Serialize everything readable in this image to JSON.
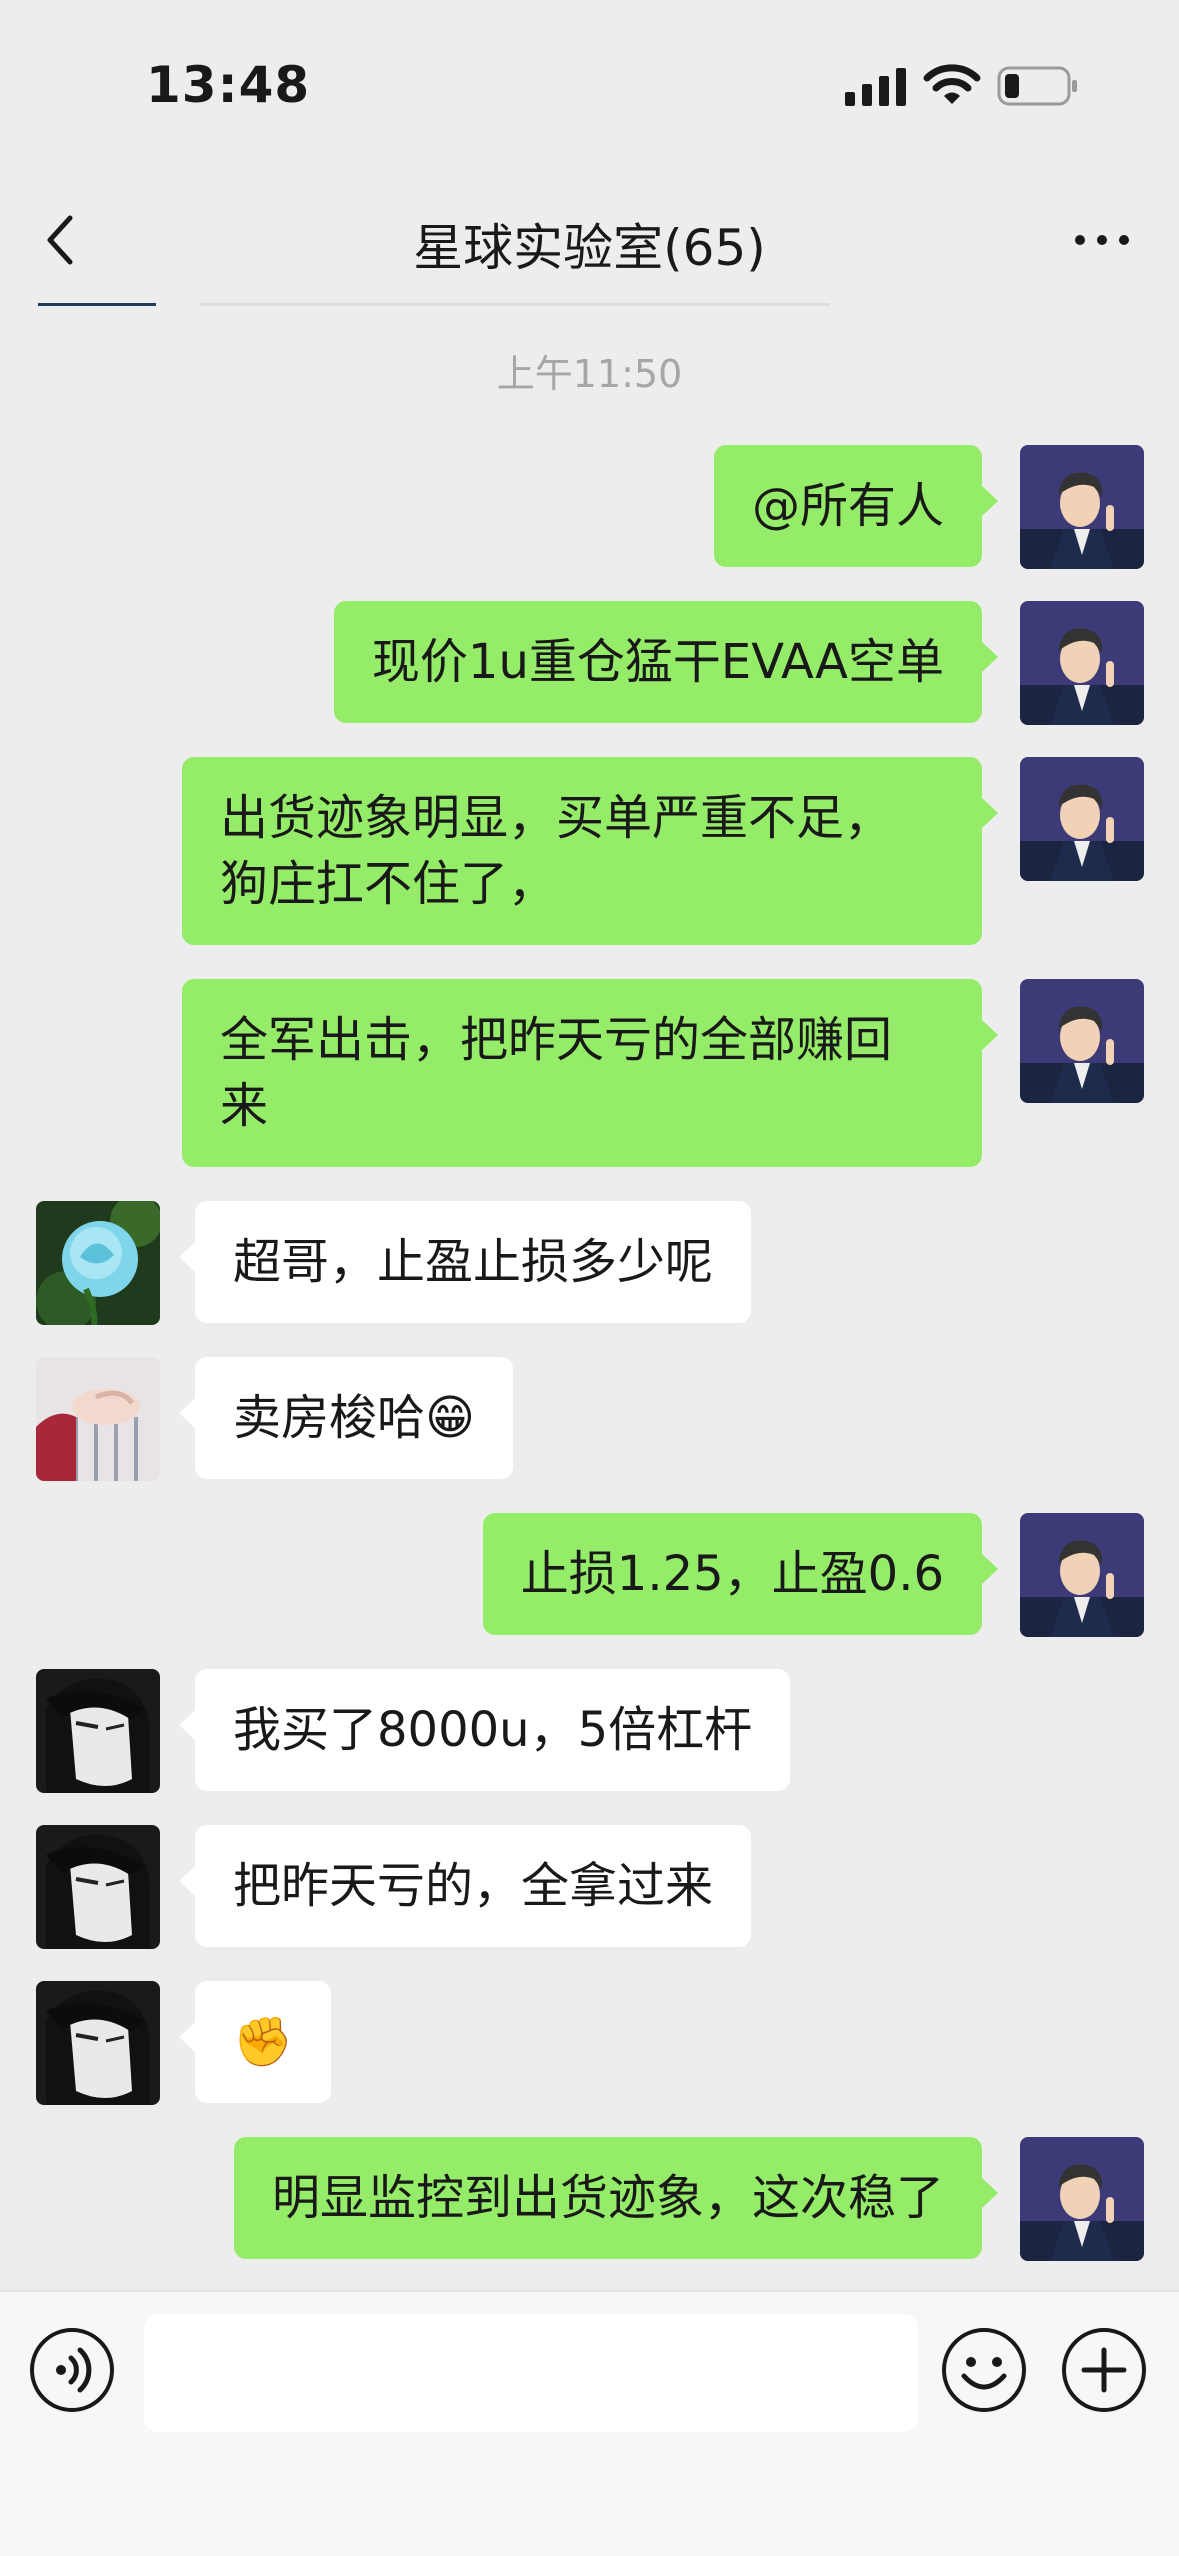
{
  "status_bar": {
    "time": "13:48"
  },
  "header": {
    "title": "星球实验室(65)"
  },
  "timestamp": "上午11:50",
  "messages": [
    {
      "side": "out",
      "text": "@所有人",
      "avatar": "man-suit-avatar"
    },
    {
      "side": "out",
      "text": "现价1u重仓猛干EVAA空单",
      "avatar": "man-suit-avatar"
    },
    {
      "side": "out",
      "text": "出货迹象明显，买单严重不足，\n狗庄扛不住了，",
      "avatar": "man-suit-avatar"
    },
    {
      "side": "out",
      "text": "全军出击，把昨天亏的全部赚回\n来",
      "avatar": "man-suit-avatar"
    },
    {
      "side": "in",
      "text": "超哥，止盈止损多少呢",
      "avatar": "blue-rose-avatar"
    },
    {
      "side": "in",
      "text": "卖房梭哈😁",
      "avatar": "hand-sweater-avatar"
    },
    {
      "side": "out",
      "text": "止损1.25，止盈0.6",
      "avatar": "man-suit-avatar"
    },
    {
      "side": "in",
      "text": "我买了8000u，5倍杠杆",
      "avatar": "anime-bw-avatar"
    },
    {
      "side": "in",
      "text": "把昨天亏的，全拿过来",
      "avatar": "anime-bw-avatar"
    },
    {
      "side": "in",
      "text": "✊",
      "avatar": "anime-bw-avatar"
    },
    {
      "side": "out",
      "text": "明显监控到出货迹象，这次稳了",
      "avatar": "man-suit-avatar"
    }
  ],
  "icons": {
    "back": "chevron-left-icon",
    "more": "more-dots-icon",
    "voice": "voice-icon",
    "emoji": "emoji-icon",
    "plus": "plus-icon"
  },
  "colors": {
    "outgoing_bubble": "#95ec69",
    "incoming_bubble": "#ffffff",
    "background": "#ededed"
  }
}
